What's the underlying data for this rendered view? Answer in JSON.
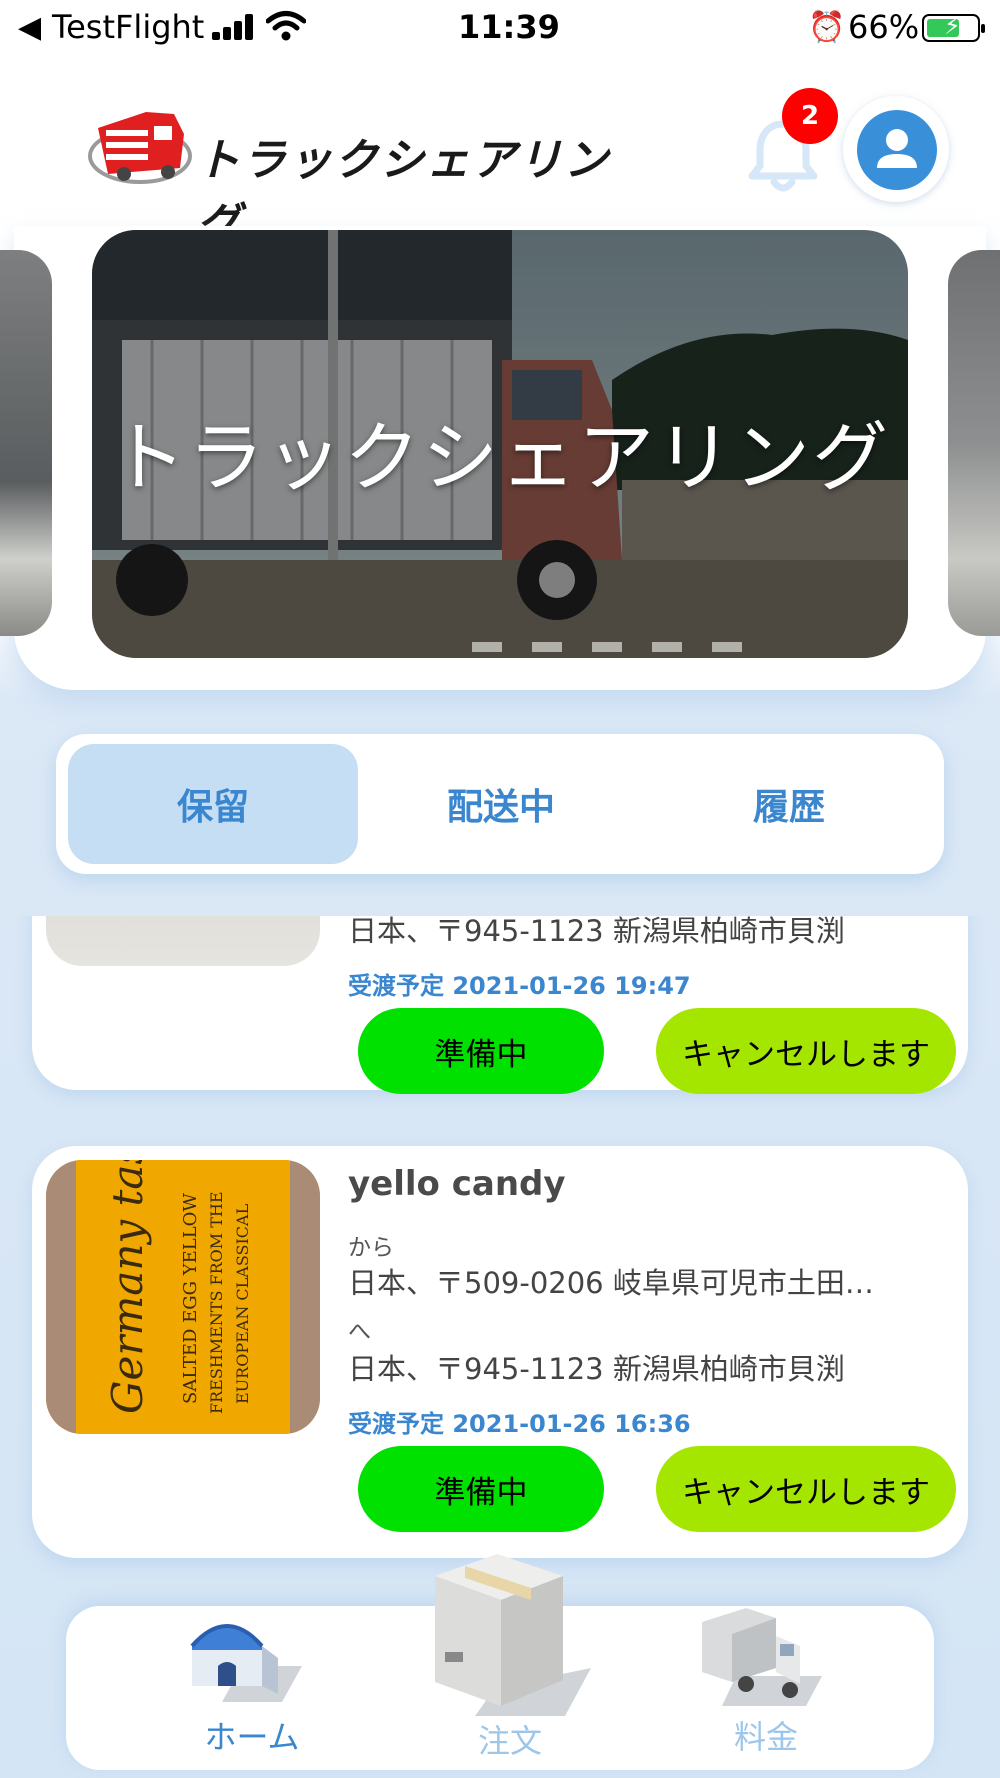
{
  "status_bar": {
    "back_app": "TestFlight",
    "time": "11:39",
    "battery": "66%"
  },
  "header": {
    "logo_text": "トラックシェアリング",
    "notification_count": "2"
  },
  "banner": {
    "title": "トラックシェアリング"
  },
  "tabs": [
    {
      "label": "保留",
      "active": true
    },
    {
      "label": "配送中",
      "active": false
    },
    {
      "label": "履歴",
      "active": false
    }
  ],
  "orders": [
    {
      "to_address": "日本、〒945-1123 新潟県柏崎市貝渕",
      "eta_label": "受渡予定",
      "eta": "2021-01-26  19:47",
      "status_button": "準備中",
      "cancel_button": "キャンセルします"
    },
    {
      "name": "yello candy",
      "from_label": "から",
      "from_address": "日本、〒509-0206 岐阜県可児市土田…",
      "to_label": "へ",
      "to_address": "日本、〒945-1123 新潟県柏崎市貝渕",
      "eta_label": "受渡予定",
      "eta": "2021-01-26  16:36",
      "status_button": "準備中",
      "cancel_button": "キャンセルします",
      "thumb_text": [
        "Germany taste",
        "SALTED EGG YELLOW",
        "FRESHMENTS FROM THE",
        "EUROPEAN CLASSICAL"
      ]
    }
  ],
  "bottom_nav": [
    {
      "label": "ホーム",
      "icon": "warehouse-icon",
      "active": true
    },
    {
      "label": "注文",
      "icon": "box-icon",
      "active": false
    },
    {
      "label": "料金",
      "icon": "truck-icon",
      "active": false
    }
  ],
  "colors": {
    "accent": "#3a86cf",
    "status_green": "#00e100",
    "cancel_green": "#a4e600",
    "badge_red": "#ff0000"
  }
}
